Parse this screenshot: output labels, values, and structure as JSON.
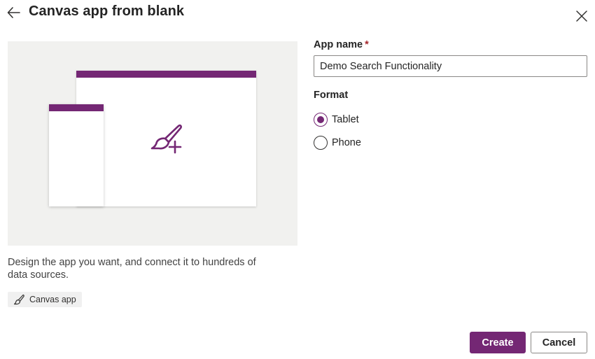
{
  "header": {
    "title": "Canvas app from blank",
    "back_icon": "arrow-left-icon",
    "close_icon": "close-icon"
  },
  "preview": {
    "background_color": "#f1f1ef",
    "accent_color": "#742774",
    "icon": "paintbrush-plus-icon"
  },
  "description": "Design the app you want, and connect it to hundreds of data sources.",
  "tag": {
    "label": "Canvas app",
    "icon": "paintbrush-icon"
  },
  "form": {
    "app_name_label": "App name",
    "required_marker": "*",
    "app_name_value": "Demo Search Functionality",
    "format_label": "Format",
    "format_options": [
      {
        "label": "Tablet",
        "selected": true
      },
      {
        "label": "Phone",
        "selected": false
      }
    ]
  },
  "footer": {
    "create_label": "Create",
    "cancel_label": "Cancel"
  },
  "colors": {
    "brand": "#742774",
    "required": "#a4262c"
  }
}
